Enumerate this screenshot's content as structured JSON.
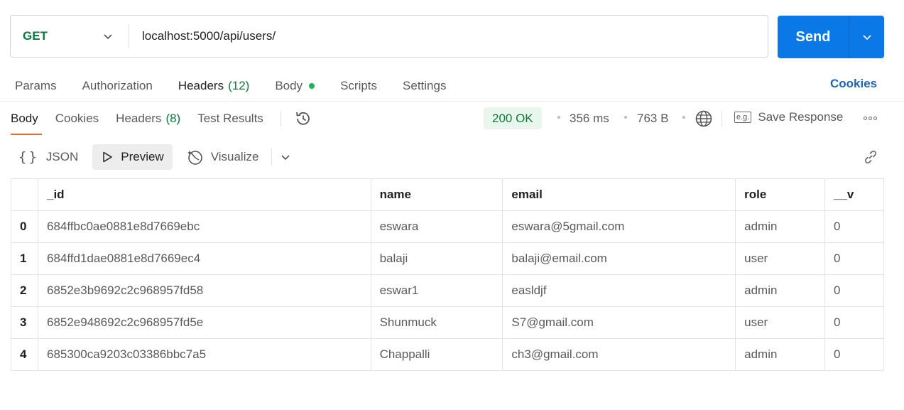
{
  "request": {
    "method": "GET",
    "url": "localhost:5000/api/users/",
    "send_label": "Send"
  },
  "request_tabs": [
    {
      "label": "Params"
    },
    {
      "label": "Authorization"
    },
    {
      "label": "Headers",
      "count": "(12)"
    },
    {
      "label": "Body"
    },
    {
      "label": "Scripts"
    },
    {
      "label": "Settings"
    }
  ],
  "cookies_link": "Cookies",
  "response_tabs": [
    {
      "label": "Body"
    },
    {
      "label": "Cookies"
    },
    {
      "label": "Headers",
      "count": "(8)"
    },
    {
      "label": "Test Results"
    }
  ],
  "response_meta": {
    "status": "200 OK",
    "time": "356 ms",
    "size": "763 B",
    "save_response": "Save Response",
    "save_icon_text": "e.g."
  },
  "view_modes": {
    "json": "JSON",
    "preview": "Preview",
    "visualize": "Visualize"
  },
  "table": {
    "columns": [
      "",
      "_id",
      "name",
      "email",
      "role",
      "__v"
    ],
    "rows": [
      [
        "0",
        "684ffbc0ae0881e8d7669ebc",
        "eswara",
        "eswara@5gmail.com",
        "admin",
        "0"
      ],
      [
        "1",
        "684ffd1dae0881e8d7669ec4",
        "balaji",
        "balaji@email.com",
        "user",
        "0"
      ],
      [
        "2",
        "6852e3b9692c2c968957fd58",
        "eswar1",
        "easldjf",
        "admin",
        "0"
      ],
      [
        "3",
        "6852e948692c2c968957fd5e",
        "Shunmuck",
        "S7@gmail.com",
        "user",
        "0"
      ],
      [
        "4",
        "685300ca9203c03386bbc7a5",
        "Chappalli",
        "ch3@gmail.com",
        "admin",
        "0"
      ]
    ]
  },
  "colors": {
    "send_button": "#0a78e6",
    "method_get": "#0b7a3b",
    "status_ok_bg": "#e8f6ec",
    "active_tab_underline": "#ef6c2c",
    "cookies_link": "#1d63b8"
  }
}
